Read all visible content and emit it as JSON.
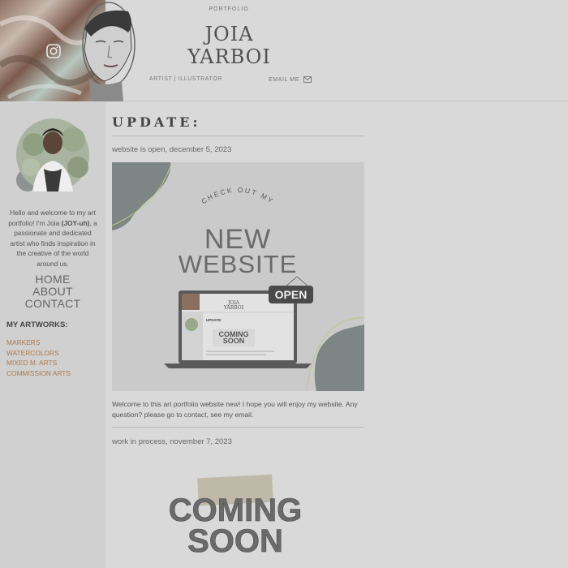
{
  "header": {
    "portfolio_label": "PORTFOLIO",
    "name_line1": "JOIA",
    "name_line2": "YARBOI",
    "role": "ARTIST | ILLUSTRATOR",
    "email_label": "EMAIL ME",
    "instagram_icon": "instagram-icon",
    "mail_icon": "mail-icon"
  },
  "sidebar": {
    "intro_part1": "Hello and welcome to my art portfolio! I'm Joia ",
    "intro_bold": "(JOY-uh)",
    "intro_part2": ", a passionate and dedicated artist who finds inspiration in the creative of the world around us.",
    "nav": [
      "HOME",
      "ABOUT",
      "CONTACT"
    ],
    "artworks_title": "MY ARTWORKS:",
    "artworks": [
      "MARKERS",
      "WATERCOLORS",
      "MIXED M. ARTS",
      "COMMISSION ARTS"
    ]
  },
  "main": {
    "section_title": "UPDATE:",
    "posts": [
      {
        "title": "website is open, december 5, 2023",
        "image": {
          "arc_text": "CHECK OUT MY",
          "headline1": "NEW",
          "headline2": "WEBSITE",
          "badge": "OPEN",
          "mini_name1": "JOIA",
          "mini_name2": "YARBOI",
          "mini_update": "UPDATE:",
          "mini_coming1": "COMING",
          "mini_coming2": "SOON"
        },
        "body": "Welcome to this art portfolio website new! I hope you will enjoy my website. Any question? please go to contact, see my email."
      },
      {
        "title": "work in process, november 7, 2023",
        "image": {
          "line1": "COMING",
          "line2": "SOON"
        }
      }
    ]
  },
  "colors": {
    "background": "#d9d9d9",
    "sidebar": "#d0d0d0",
    "artwork_link": "#b07a4a",
    "shape_dark": "#7d8684",
    "accent_line": "#b9c98a"
  }
}
